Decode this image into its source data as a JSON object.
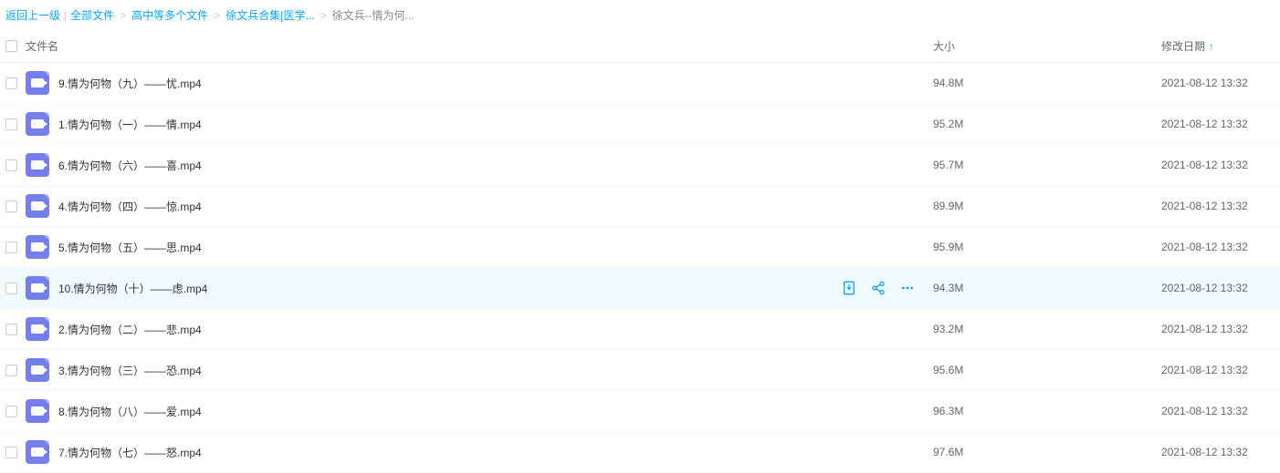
{
  "breadcrumb": {
    "back": "返回上一级",
    "items": [
      {
        "label": "全部文件"
      },
      {
        "label": "高中等多个文件"
      },
      {
        "label": "徐文兵合集[医学..."
      }
    ],
    "current": "徐文兵--情为何..."
  },
  "headers": {
    "name": "文件名",
    "size": "大小",
    "date": "修改日期"
  },
  "files": [
    {
      "name": "9.情为何物（九）——忧.mp4",
      "size": "94.8M",
      "date": "2021-08-12 13:32",
      "hovered": false
    },
    {
      "name": "1.情为何物（一）——情.mp4",
      "size": "95.2M",
      "date": "2021-08-12 13:32",
      "hovered": false
    },
    {
      "name": "6.情为何物（六）——喜.mp4",
      "size": "95.7M",
      "date": "2021-08-12 13:32",
      "hovered": false
    },
    {
      "name": "4.情为何物（四）——惊.mp4",
      "size": "89.9M",
      "date": "2021-08-12 13:32",
      "hovered": false
    },
    {
      "name": "5.情为何物（五）——思.mp4",
      "size": "95.9M",
      "date": "2021-08-12 13:32",
      "hovered": false
    },
    {
      "name": "10.情为何物（十）——虑.mp4",
      "size": "94.3M",
      "date": "2021-08-12 13:32",
      "hovered": true
    },
    {
      "name": "2.情为何物（二）——悲.mp4",
      "size": "93.2M",
      "date": "2021-08-12 13:32",
      "hovered": false
    },
    {
      "name": "3.情为何物（三）——恐.mp4",
      "size": "95.6M",
      "date": "2021-08-12 13:32",
      "hovered": false
    },
    {
      "name": "8.情为何物（八）——爱.mp4",
      "size": "96.3M",
      "date": "2021-08-12 13:32",
      "hovered": false
    },
    {
      "name": "7.情为何物（七）——怒.mp4",
      "size": "97.6M",
      "date": "2021-08-12 13:32",
      "hovered": false
    }
  ]
}
